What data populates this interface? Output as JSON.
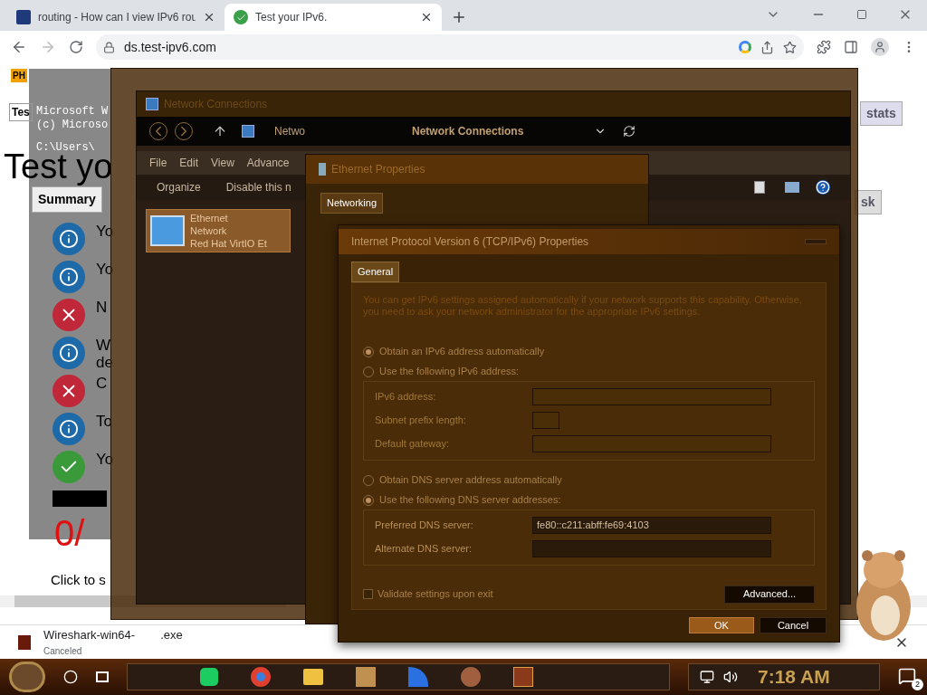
{
  "browser": {
    "tabs": [
      {
        "title": "routing - How can I view IPv6 rou",
        "selected": false
      },
      {
        "title": "Test your IPv6.",
        "selected": true
      }
    ],
    "address": "ds.test-ipv6.com",
    "bookmark_icon": "PH"
  },
  "page": {
    "tabs": [
      "Tes",
      "Summary",
      "stats",
      "sk"
    ],
    "heading": "Test yo",
    "results": [
      {
        "kind": "info",
        "text": "Yo"
      },
      {
        "kind": "info",
        "text": "Yo"
      },
      {
        "kind": "error",
        "text": "N"
      },
      {
        "kind": "info",
        "text": "W",
        "extra": "de"
      },
      {
        "kind": "error",
        "text": "C"
      },
      {
        "kind": "info",
        "text": "To"
      },
      {
        "kind": "ok",
        "text": "Yo"
      }
    ],
    "score": "0/",
    "footer": "Click to s"
  },
  "terminal": {
    "lines": [
      "Microsoft W",
      "(c) Microso",
      "C:\\Users\\"
    ]
  },
  "network_connections": {
    "title": "Network Connections",
    "path": "Netwo",
    "location": "Network Connections",
    "menu": [
      "File",
      "Edit",
      "View",
      "Advance"
    ],
    "toolbar": [
      "Organize",
      "Disable this n"
    ],
    "item": {
      "name": "Ethernet",
      "status": "Network",
      "device": "Red Hat VirtIO Et"
    }
  },
  "ethernet_properties": {
    "title": "Ethernet Properties",
    "tabs": [
      {
        "label": "Networking",
        "selected": true
      }
    ]
  },
  "ipv6_dialog": {
    "title": "Internet Protocol Version 6 (TCP/IPv6) Properties",
    "tabs": [
      {
        "label": "General",
        "selected": true
      }
    ],
    "description": "You can get IPv6 settings assigned automatically if your network supports this capability. Otherwise, you need to ask your network administrator for the appropriate IPv6 settings.",
    "address_options": [
      {
        "label": "Obtain an IPv6 address automatically",
        "selected": true
      },
      {
        "label": "Use the following IPv6 address:",
        "selected": false
      }
    ],
    "address_fields": [
      {
        "label": "IPv6 address:",
        "kind": "wide",
        "disabled": true
      },
      {
        "label": "Subnet prefix length:",
        "kind": "short",
        "disabled": true
      },
      {
        "label": "Default gateway:",
        "kind": "wide",
        "disabled": true
      }
    ],
    "dns_options": [
      {
        "label": "Obtain DNS server address automatically",
        "selected": false
      },
      {
        "label": "Use the following DNS server addresses:",
        "selected": true
      }
    ],
    "dns_fields": [
      {
        "label": "Preferred DNS server:",
        "disabled": false,
        "value": "fe80::c211:abff:fe69:4103"
      },
      {
        "label": "Alternate DNS server:",
        "disabled": false
      }
    ],
    "validate": {
      "label": "Validate settings upon exit",
      "checked": false
    },
    "advanced": "Advanced...",
    "ok": "OK",
    "cancel": "Cancel"
  },
  "download": {
    "file": "Wireshark-win64-",
    "file_end": ".exe",
    "status": "Canceled"
  },
  "taskbar": {
    "time": "7:18 AM",
    "notifications": "2"
  }
}
